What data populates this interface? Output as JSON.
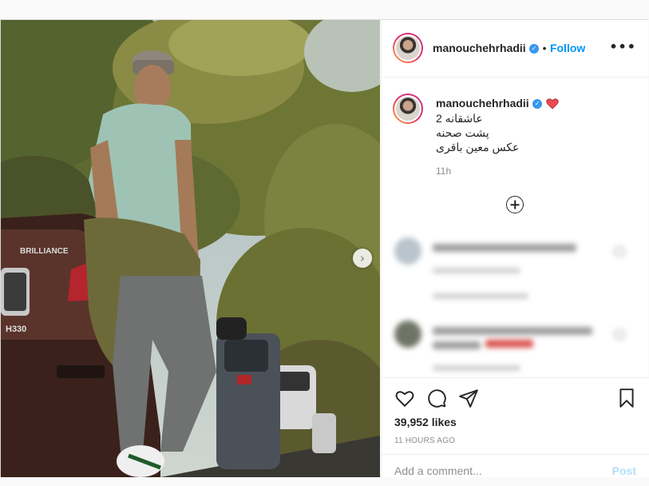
{
  "post": {
    "username": "manouchehrhadii",
    "follow_label": "Follow",
    "dot": "•",
    "more_label": "•••",
    "nav_next": "›"
  },
  "caption": {
    "username": "manouchehrhadii",
    "lines": [
      "عاشقانه 2",
      "پشت صحنه",
      "عکس معین باقری"
    ],
    "time": "11h"
  },
  "actions": {
    "likes": "39,952 likes",
    "time_ago": "11 HOURS AGO",
    "comment_placeholder": "Add a comment...",
    "post_label": "Post"
  },
  "colors": {
    "accent": "#0095f6",
    "verified": "#3897f0",
    "heart": "#ed4956"
  },
  "icons": [
    "verified-icon",
    "heart-emoji-icon",
    "plus-circle-icon",
    "heart-icon",
    "comment-icon",
    "share-icon",
    "bookmark-icon",
    "more-icon",
    "chevron-right-icon"
  ]
}
